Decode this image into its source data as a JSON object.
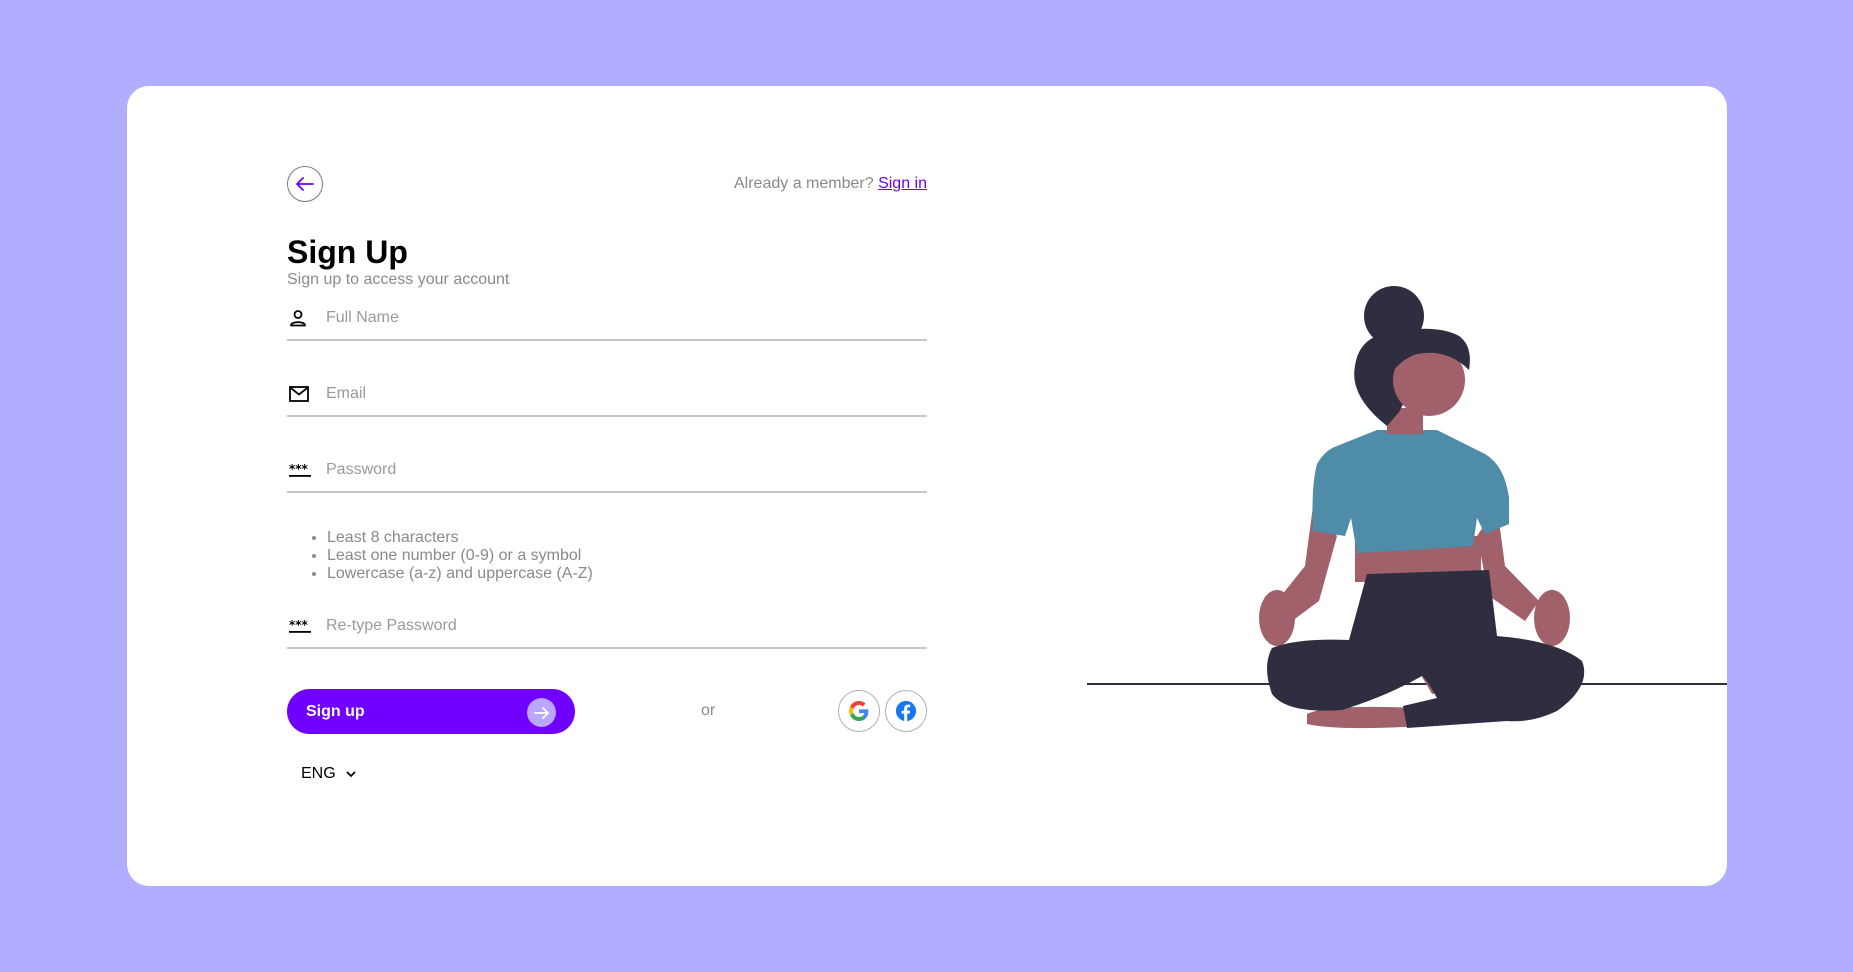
{
  "header": {
    "member_text": "Already a member?",
    "signin_label": "Sign in"
  },
  "title": "Sign Up",
  "subtitle": "Sign up to access your account",
  "fields": {
    "full_name": "Full Name",
    "email": "Email",
    "password": "Password",
    "retype_password": "Re-type Password"
  },
  "password_rules": [
    "Least 8 characters",
    "Least one number (0-9) or a symbol",
    "Lowercase (a-z) and uppercase (A-Z)"
  ],
  "actions": {
    "signup_label": "Sign up",
    "or_label": "or"
  },
  "language": "ENG",
  "colors": {
    "background": "#b1adff",
    "accent": "#7000ff",
    "shirt": "#4e8ca8",
    "pants": "#2f2e41",
    "skin": "#a0616a"
  }
}
